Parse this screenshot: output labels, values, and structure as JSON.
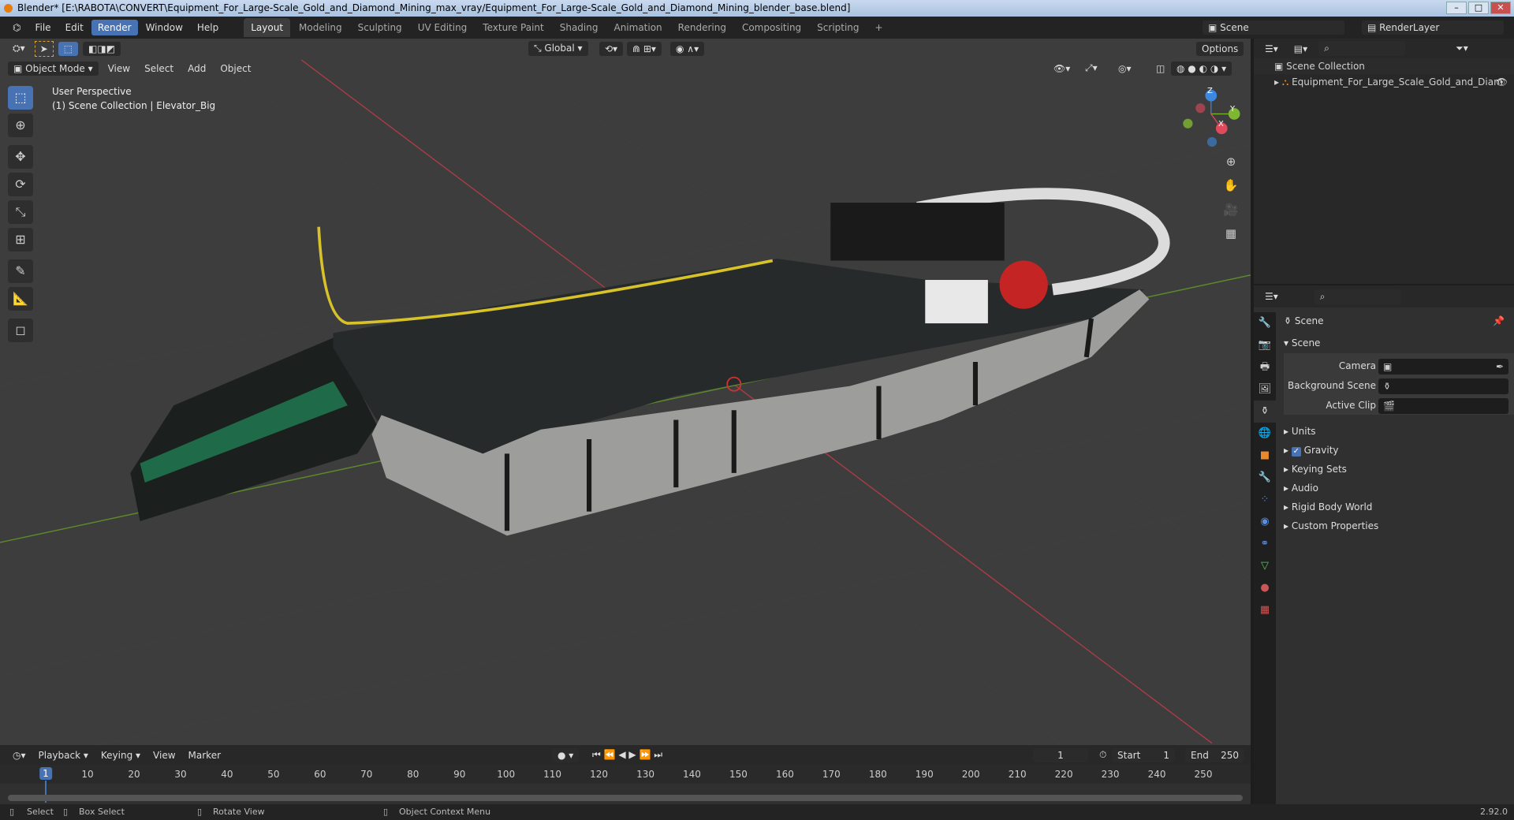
{
  "window": {
    "title": "Blender* [E:\\RABOTA\\CONVERT\\Equipment_For_Large-Scale_Gold_and_Diamond_Mining_max_vray/Equipment_For_Large-Scale_Gold_and_Diamond_Mining_blender_base.blend]",
    "minimize": "–",
    "maximize": "□",
    "close": "✕"
  },
  "menu": [
    "File",
    "Edit",
    "Render",
    "Window",
    "Help"
  ],
  "workspaces": [
    "Layout",
    "Modeling",
    "Sculpting",
    "UV Editing",
    "Texture Paint",
    "Shading",
    "Animation",
    "Rendering",
    "Compositing",
    "Scripting",
    "+"
  ],
  "topright": {
    "scene": "Scene",
    "view_layer": "RenderLayer"
  },
  "viewport": {
    "transform_orientation": "Global",
    "options": "Options",
    "mode": "Object Mode",
    "menus": [
      "View",
      "Select",
      "Add",
      "Object"
    ],
    "perspective": "User Perspective",
    "collection_info": "(1) Scene Collection | Elevator_Big",
    "axes": {
      "x": "X",
      "y": "Y",
      "z": "Z"
    }
  },
  "outliner": {
    "root": "Scene Collection",
    "item": "Equipment_For_Large_Scale_Gold_and_Diam"
  },
  "properties": {
    "header": "Scene",
    "panel": "Scene",
    "camera_label": "Camera",
    "bg_scene_label": "Background Scene",
    "active_clip_label": "Active Clip",
    "sections": [
      "Units",
      "Gravity",
      "Keying Sets",
      "Audio",
      "Rigid Body World",
      "Custom Properties"
    ],
    "gravity_checked": true
  },
  "timeline": {
    "menus": [
      "Playback",
      "Keying",
      "View",
      "Marker"
    ],
    "current_frame": "1",
    "start_label": "Start",
    "start": "1",
    "end_label": "End",
    "end": "250",
    "ticks": [
      "1",
      "10",
      "20",
      "30",
      "40",
      "50",
      "60",
      "70",
      "80",
      "90",
      "100",
      "110",
      "120",
      "130",
      "140",
      "150",
      "160",
      "170",
      "180",
      "190",
      "200",
      "210",
      "220",
      "230",
      "240",
      "250"
    ]
  },
  "status": {
    "select": "Select",
    "box_select": "Box Select",
    "rotate_view": "Rotate View",
    "context_menu": "Object Context Menu",
    "version": "2.92.0"
  },
  "colors": {
    "accent": "#4772b3",
    "axis_x": "#e04a5a",
    "axis_y": "#7eb830",
    "axis_z": "#3c88e0"
  }
}
